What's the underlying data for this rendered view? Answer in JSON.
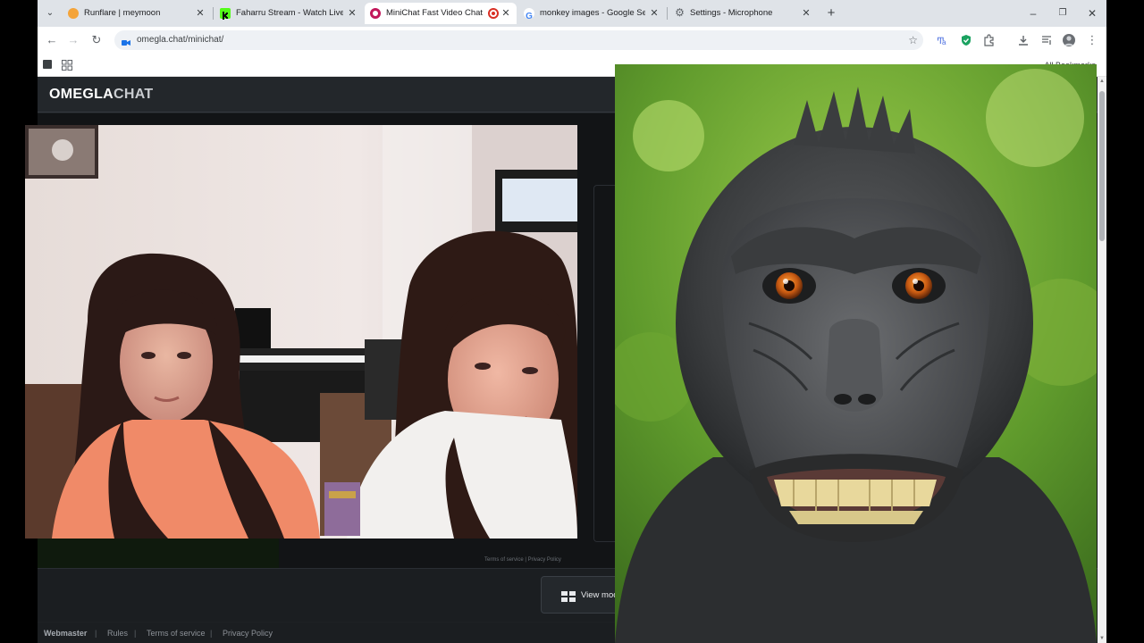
{
  "browser": {
    "tabs": [
      {
        "title": "Runflare | meymoon",
        "icon": "runflare-icon",
        "color": "#f4a43a",
        "active": false
      },
      {
        "title": "Faharru Stream - Watch Live on",
        "icon": "kick-icon",
        "color": "#53fc18",
        "active": false
      },
      {
        "title": "MiniChat Fast Video Chat -",
        "icon": "minichat-icon",
        "color": "#c2185b",
        "active": true,
        "recording": true
      },
      {
        "title": "monkey images - Google Search",
        "icon": "google-icon",
        "color": "#4285f4",
        "active": false
      },
      {
        "title": "Settings - Microphone",
        "icon": "gear-icon",
        "color": "#5f6368",
        "active": false
      }
    ],
    "url": "omegla.chat/minichat/",
    "bookmarks_all": "All Bookmarks"
  },
  "site": {
    "logo_part1": "OMEGLA",
    "logo_part2": "CHAT",
    "view_mode_label": "View mode",
    "inner_footer": "Terms of service   |   Privacy Policy",
    "footer": {
      "webmaster": "Webmaster",
      "rules": "Rules",
      "terms": "Terms of service",
      "privacy": "Privacy Policy",
      "sep": "|"
    }
  },
  "overlays": {
    "left_video": "video-stream-two-women",
    "right_image": "macaque-selfie-photo"
  },
  "colors": {
    "header_bg": "#23272b",
    "page_bg": "#121416",
    "active_tab": "#ffffff",
    "tabstrip": "#dfe3e8"
  }
}
